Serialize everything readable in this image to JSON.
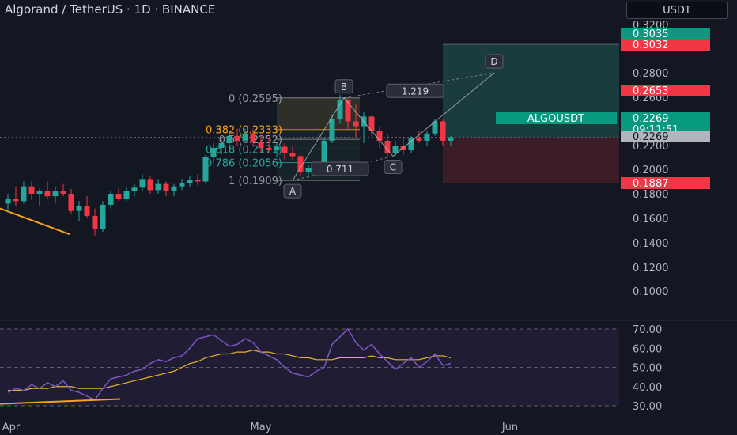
{
  "header": {
    "title": "Algorand / TetherUS · 1D · BINANCE",
    "currency": "USDT"
  },
  "colors": {
    "background": "#131722",
    "up": "#26a69a",
    "down": "#f23645",
    "rsi_line": "#7e57c2",
    "rsi_ma": "#e6b52c",
    "trendline": "#f7a21b",
    "label_green": "#089981",
    "label_red": "#f23645"
  },
  "chart_data": [
    {
      "type": "candlestick",
      "title": "Algorand / TetherUS · 1D · BINANCE",
      "y_ticks": [
        "0.3200",
        "0.2800",
        "0.2600",
        "0.2200",
        "0.2000",
        "0.1800",
        "0.1600",
        "0.1400",
        "0.1200",
        "0.1000"
      ],
      "x_ticks": [
        "Apr",
        "May",
        "Jun"
      ],
      "ylim": [
        0.09,
        0.33
      ],
      "scale": "linear",
      "grid": false,
      "candles": [
        {
          "o": 0.172,
          "h": 0.18,
          "l": 0.165,
          "c": 0.176
        },
        {
          "o": 0.176,
          "h": 0.186,
          "l": 0.17,
          "c": 0.174
        },
        {
          "o": 0.174,
          "h": 0.19,
          "l": 0.172,
          "c": 0.186
        },
        {
          "o": 0.186,
          "h": 0.19,
          "l": 0.175,
          "c": 0.18
        },
        {
          "o": 0.18,
          "h": 0.184,
          "l": 0.17,
          "c": 0.182
        },
        {
          "o": 0.182,
          "h": 0.19,
          "l": 0.176,
          "c": 0.178
        },
        {
          "o": 0.178,
          "h": 0.186,
          "l": 0.172,
          "c": 0.182
        },
        {
          "o": 0.182,
          "h": 0.188,
          "l": 0.178,
          "c": 0.18
        },
        {
          "o": 0.18,
          "h": 0.184,
          "l": 0.164,
          "c": 0.166
        },
        {
          "o": 0.166,
          "h": 0.174,
          "l": 0.158,
          "c": 0.17
        },
        {
          "o": 0.17,
          "h": 0.178,
          "l": 0.16,
          "c": 0.162
        },
        {
          "o": 0.162,
          "h": 0.168,
          "l": 0.146,
          "c": 0.151
        },
        {
          "o": 0.151,
          "h": 0.174,
          "l": 0.149,
          "c": 0.171
        },
        {
          "o": 0.171,
          "h": 0.182,
          "l": 0.168,
          "c": 0.18
        },
        {
          "o": 0.18,
          "h": 0.184,
          "l": 0.174,
          "c": 0.176
        },
        {
          "o": 0.176,
          "h": 0.186,
          "l": 0.174,
          "c": 0.182
        },
        {
          "o": 0.182,
          "h": 0.188,
          "l": 0.178,
          "c": 0.185
        },
        {
          "o": 0.185,
          "h": 0.196,
          "l": 0.182,
          "c": 0.192
        },
        {
          "o": 0.192,
          "h": 0.194,
          "l": 0.18,
          "c": 0.183
        },
        {
          "o": 0.183,
          "h": 0.192,
          "l": 0.18,
          "c": 0.188
        },
        {
          "o": 0.188,
          "h": 0.19,
          "l": 0.178,
          "c": 0.182
        },
        {
          "o": 0.182,
          "h": 0.188,
          "l": 0.178,
          "c": 0.186
        },
        {
          "o": 0.186,
          "h": 0.192,
          "l": 0.183,
          "c": 0.189
        },
        {
          "o": 0.189,
          "h": 0.194,
          "l": 0.186,
          "c": 0.191
        },
        {
          "o": 0.191,
          "h": 0.196,
          "l": 0.187,
          "c": 0.19
        },
        {
          "o": 0.19,
          "h": 0.212,
          "l": 0.188,
          "c": 0.21
        },
        {
          "o": 0.21,
          "h": 0.222,
          "l": 0.205,
          "c": 0.218
        },
        {
          "o": 0.218,
          "h": 0.226,
          "l": 0.212,
          "c": 0.222
        },
        {
          "o": 0.222,
          "h": 0.232,
          "l": 0.216,
          "c": 0.228
        },
        {
          "o": 0.228,
          "h": 0.234,
          "l": 0.22,
          "c": 0.224
        },
        {
          "o": 0.224,
          "h": 0.234,
          "l": 0.222,
          "c": 0.23
        },
        {
          "o": 0.23,
          "h": 0.234,
          "l": 0.22,
          "c": 0.223
        },
        {
          "o": 0.223,
          "h": 0.228,
          "l": 0.214,
          "c": 0.218
        },
        {
          "o": 0.218,
          "h": 0.226,
          "l": 0.214,
          "c": 0.216
        },
        {
          "o": 0.216,
          "h": 0.222,
          "l": 0.21,
          "c": 0.219
        },
        {
          "o": 0.219,
          "h": 0.222,
          "l": 0.208,
          "c": 0.214
        },
        {
          "o": 0.214,
          "h": 0.22,
          "l": 0.208,
          "c": 0.211
        },
        {
          "o": 0.211,
          "h": 0.212,
          "l": 0.194,
          "c": 0.198
        },
        {
          "o": 0.198,
          "h": 0.204,
          "l": 0.193,
          "c": 0.201
        },
        {
          "o": 0.201,
          "h": 0.204,
          "l": 0.194,
          "c": 0.196
        },
        {
          "o": 0.196,
          "h": 0.226,
          "l": 0.195,
          "c": 0.224
        },
        {
          "o": 0.224,
          "h": 0.246,
          "l": 0.222,
          "c": 0.242
        },
        {
          "o": 0.242,
          "h": 0.262,
          "l": 0.238,
          "c": 0.258
        },
        {
          "o": 0.258,
          "h": 0.259,
          "l": 0.234,
          "c": 0.24
        },
        {
          "o": 0.24,
          "h": 0.254,
          "l": 0.226,
          "c": 0.236
        },
        {
          "o": 0.236,
          "h": 0.248,
          "l": 0.222,
          "c": 0.244
        },
        {
          "o": 0.244,
          "h": 0.246,
          "l": 0.228,
          "c": 0.232
        },
        {
          "o": 0.232,
          "h": 0.236,
          "l": 0.218,
          "c": 0.224
        },
        {
          "o": 0.224,
          "h": 0.23,
          "l": 0.21,
          "c": 0.214
        },
        {
          "o": 0.214,
          "h": 0.224,
          "l": 0.211,
          "c": 0.22
        },
        {
          "o": 0.22,
          "h": 0.226,
          "l": 0.212,
          "c": 0.216
        },
        {
          "o": 0.216,
          "h": 0.228,
          "l": 0.214,
          "c": 0.226
        },
        {
          "o": 0.226,
          "h": 0.232,
          "l": 0.222,
          "c": 0.224
        },
        {
          "o": 0.224,
          "h": 0.232,
          "l": 0.22,
          "c": 0.23
        },
        {
          "o": 0.23,
          "h": 0.242,
          "l": 0.228,
          "c": 0.24
        },
        {
          "o": 0.24,
          "h": 0.242,
          "l": 0.22,
          "c": 0.224
        },
        {
          "o": 0.224,
          "h": 0.228,
          "l": 0.22,
          "c": 0.2269
        }
      ],
      "price_labels": [
        {
          "text": "0.3035",
          "color": "green"
        },
        {
          "text": "0.3032",
          "color": "red"
        },
        {
          "text": "0.2653",
          "color": "red"
        },
        {
          "text": "0.2269",
          "color": "green",
          "symbol": "ALGOUSDT",
          "countdown": "09:11:51"
        },
        {
          "text": "0.2269",
          "color": "gray"
        },
        {
          "text": "0.1887",
          "color": "red"
        }
      ],
      "fib_levels": [
        {
          "label": "0 (0.2595)",
          "value": 0.2595,
          "color": "#9598a1"
        },
        {
          "label": "0.382 (0.2333)",
          "value": 0.2333,
          "color": "#f7a21b"
        },
        {
          "label": "0.5 (0.2252)",
          "value": 0.2252,
          "color": "#9598a1"
        },
        {
          "label": "0.618 (0.2171)",
          "value": 0.2171,
          "color": "#26a69a"
        },
        {
          "label": "0.786 (0.2056)",
          "value": 0.2056,
          "color": "#26a69a"
        },
        {
          "label": "1 (0.1909)",
          "value": 0.1909,
          "color": "#9598a1"
        }
      ],
      "harmonic_points": [
        "A",
        "B",
        "C",
        "D"
      ],
      "harmonic_ratios": [
        "0.711",
        "1.219"
      ],
      "position": {
        "target": 0.3035,
        "entry": 0.2269,
        "stop": 0.1887
      }
    },
    {
      "type": "line",
      "title": "",
      "y_ticks": [
        "70.00",
        "60.00",
        "50.00",
        "40.00",
        "30.00"
      ],
      "ylim": [
        28,
        73
      ],
      "band": [
        30,
        70
      ],
      "series": [
        {
          "values": [
            37,
            39,
            38,
            41,
            39,
            42,
            40,
            43,
            38,
            37,
            35,
            33,
            39,
            44,
            45,
            46,
            48,
            49,
            52,
            54,
            53,
            55,
            56,
            60,
            65,
            66,
            67,
            64,
            61,
            62,
            65,
            63,
            58,
            56,
            54,
            50,
            47,
            46,
            45,
            48,
            50,
            62,
            66,
            70,
            63,
            59,
            62,
            57,
            53,
            49,
            52,
            55,
            50,
            53,
            57,
            51,
            52
          ]
        },
        {
          "values": [
            38,
            38,
            38,
            39,
            39,
            39,
            40,
            40,
            40,
            39,
            39,
            39,
            39,
            40,
            41,
            42,
            43,
            44,
            45,
            46,
            47,
            48,
            50,
            52,
            53,
            55,
            56,
            57,
            57,
            58,
            58,
            59,
            58,
            58,
            57,
            57,
            56,
            55,
            55,
            54,
            54,
            54,
            55,
            55,
            55,
            55,
            56,
            55,
            55,
            54,
            54,
            54,
            54,
            55,
            56,
            56,
            55
          ]
        }
      ]
    }
  ]
}
